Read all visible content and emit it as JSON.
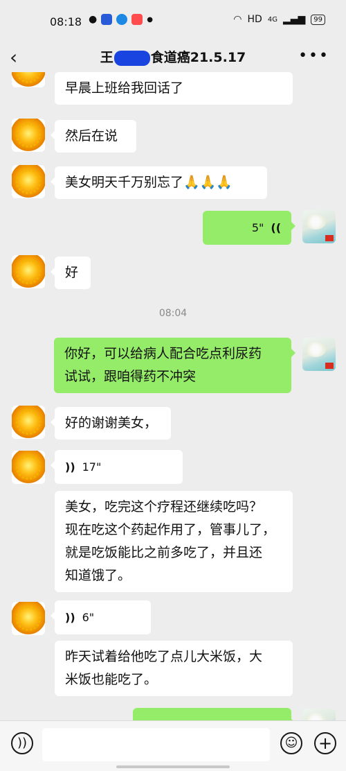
{
  "status_bar": {
    "time": "08:18",
    "network": "HD",
    "signal": "4G",
    "battery": "99"
  },
  "nav": {
    "back_icon": "chevron-left-icon",
    "title_prefix": "王",
    "title_suffix": "食道癌21.5.17",
    "more_icon": "ellipsis-icon"
  },
  "messages": [
    {
      "side": "left",
      "type": "text",
      "text": "早晨上班给我回话了"
    },
    {
      "side": "left",
      "type": "text",
      "text": "然后在说"
    },
    {
      "side": "left",
      "type": "text",
      "text": "美女明天千万别忘了🙏🙏🙏"
    },
    {
      "side": "right",
      "type": "voice",
      "duration": "5\""
    },
    {
      "side": "left",
      "type": "text",
      "text": "好"
    },
    {
      "type": "time",
      "text": "08:04"
    },
    {
      "side": "right",
      "type": "text",
      "lines": [
        "你好，可以给病人配合吃点利尿药",
        "试试，跟咱得药不冲突"
      ]
    },
    {
      "side": "left",
      "type": "text",
      "text": "好的谢谢美女，"
    },
    {
      "side": "left",
      "type": "voice",
      "duration": "17\""
    },
    {
      "side": "left",
      "type": "text",
      "lines": [
        "美女，吃完这个疗程还继续吃吗？",
        "现在吃这个药起作用了，管事儿了，",
        "就是吃饭能比之前多吃了，并且还",
        "知道饿了。"
      ]
    },
    {
      "side": "left",
      "type": "voice",
      "duration": "6\""
    },
    {
      "side": "left",
      "type": "text",
      "lines": [
        "昨天试着给他吃了点儿大米饭，大",
        "米饭也能吃了。"
      ]
    }
  ],
  "bottom_bar": {
    "voice_icon": "voice-input-icon",
    "emoji_icon": "emoji-icon",
    "plus_icon": "plus-icon"
  }
}
